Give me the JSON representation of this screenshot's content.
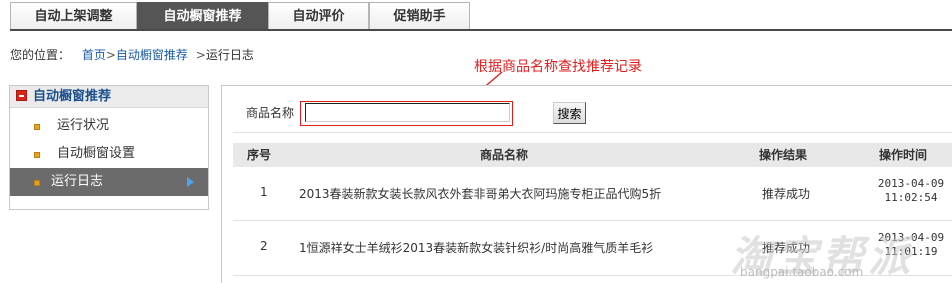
{
  "tabs": [
    {
      "label": "自动上架调整",
      "active": false
    },
    {
      "label": "自动橱窗推荐",
      "active": true
    },
    {
      "label": "自动评价",
      "active": false
    },
    {
      "label": "促销助手",
      "active": false
    }
  ],
  "breadcrumb": {
    "prefix": "您的位置：",
    "home": "首页",
    "section": "自动橱窗推荐",
    "current": "运行日志",
    "sep": ">"
  },
  "annotation": {
    "text": "根据商品名称查找推荐记录",
    "color": "#e51c1c"
  },
  "sidebar": {
    "header": "自动橱窗推荐",
    "items": [
      {
        "label": "运行状况",
        "active": false
      },
      {
        "label": "自动橱窗设置",
        "active": false
      },
      {
        "label": "运行日志",
        "active": true
      }
    ]
  },
  "search": {
    "label": "商品名称",
    "value": "",
    "placeholder": "",
    "button": "搜索"
  },
  "table": {
    "headers": [
      "序号",
      "商品名称",
      "操作结果",
      "操作时间"
    ],
    "rows": [
      {
        "no": "1",
        "name": "2013春装新款女装长款风衣外套非哥弟大衣阿玛施专柜正品代购5折",
        "result": "推荐成功",
        "date": "2013-04-09",
        "time": "11:02:54"
      },
      {
        "no": "2",
        "name": "1恒源祥女士羊绒衫2013春装新款女装针织衫/时尚高雅气质羊毛衫",
        "result": "推荐成功",
        "date": "2013-04-09",
        "time": "11:01:19"
      }
    ]
  },
  "watermark": {
    "text": "淘宝帮派",
    "url": "bangpai.taobao.com"
  },
  "colors": {
    "tab_active": "#555555",
    "link": "#1a5aa5",
    "sidebar_active": "#6b6b6b",
    "accent_red": "#e51c1c"
  }
}
